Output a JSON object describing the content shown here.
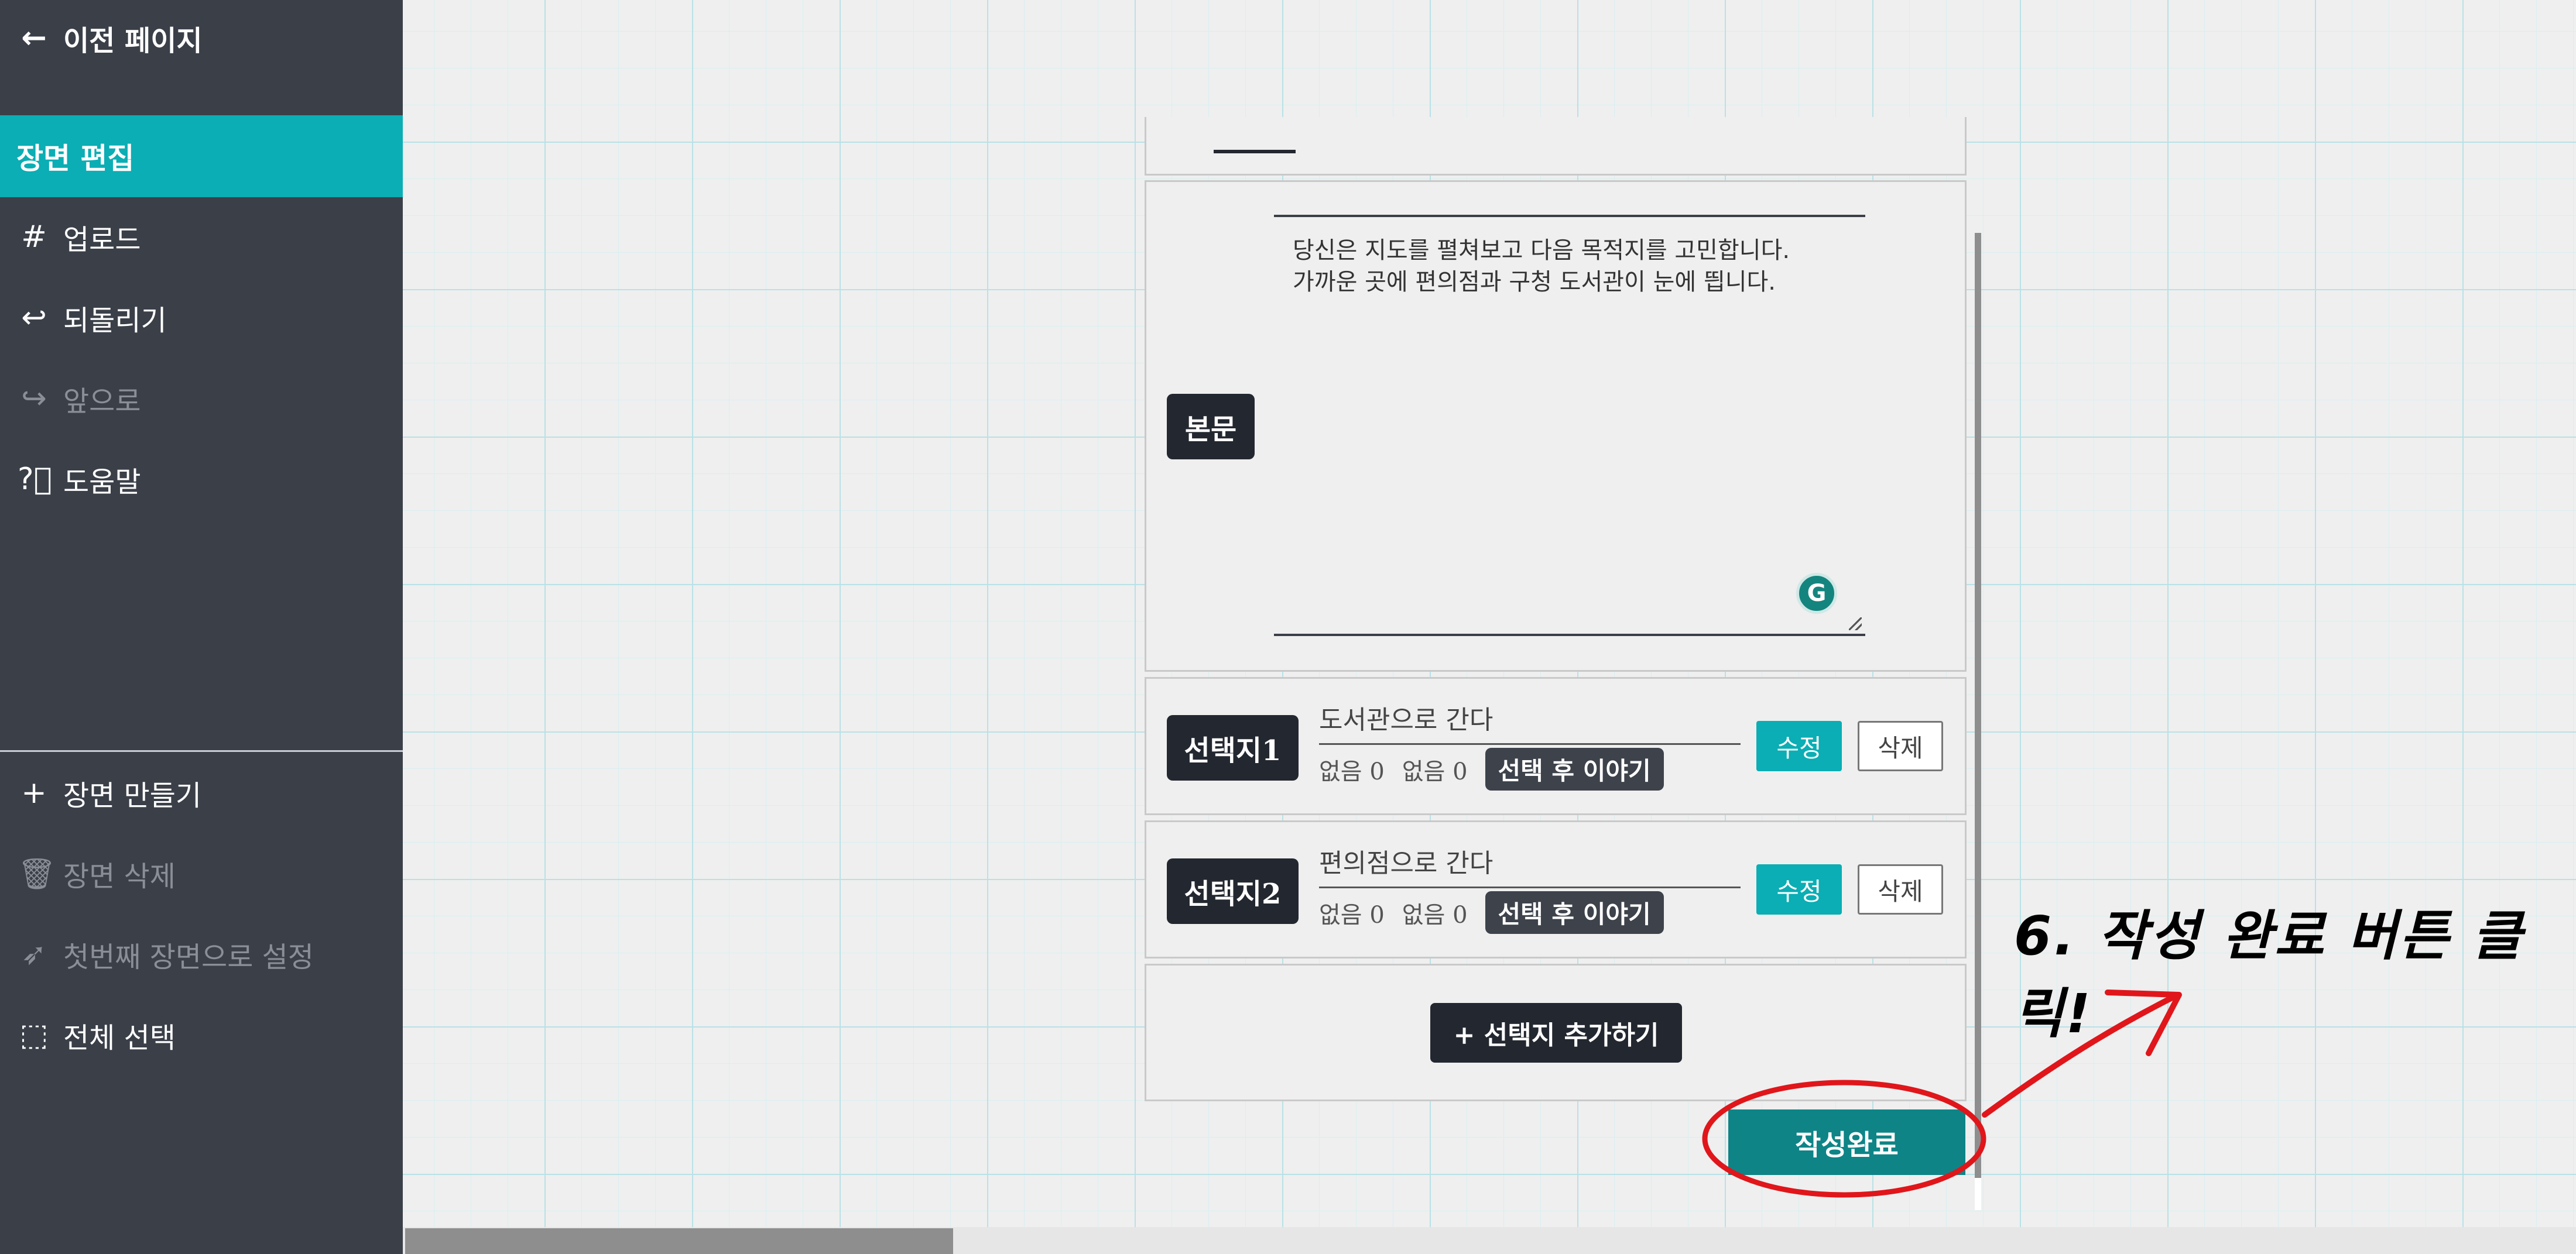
{
  "sidebar": {
    "back_label": "이전 페이지",
    "active_label": "장면 편집",
    "upload_label": "업로드",
    "undo_label": "되돌리기",
    "redo_label": "앞으로",
    "help_label": "도움말",
    "create_scene_label": "장면 만들기",
    "delete_scene_label": "장면 삭제",
    "set_first_label": "첫번째 장면으로 설정",
    "select_all_label": "전체 선택"
  },
  "editor": {
    "body_tag": "본문",
    "body_text": "당신은 지도를 펼쳐보고 다음 목적지를 고민합니다.\n가까운 곳에 편의점과 구청 도서관이 눈에 띕니다.",
    "choices": [
      {
        "tag": "선택지1",
        "title": "도서관으로 간다",
        "meta1": "없음 0",
        "meta2": "없음 0",
        "story_label": "선택 후 이야기",
        "edit_label": "수정",
        "delete_label": "삭제"
      },
      {
        "tag": "선택지2",
        "title": "편의점으로 간다",
        "meta1": "없음 0",
        "meta2": "없음 0",
        "story_label": "선택 후 이야기",
        "edit_label": "수정",
        "delete_label": "삭제"
      }
    ],
    "add_choice_label": "+ 선택지 추가하기",
    "done_label": "작성완료"
  },
  "annotation": {
    "text": "6. 작성 완료 버튼 클릭!",
    "color": "#e0161b"
  },
  "colors": {
    "sidebar_bg": "#3a3f48",
    "accent": "#0aaeb4",
    "done_button": "#0e8487",
    "dark_tag": "#23272f"
  }
}
